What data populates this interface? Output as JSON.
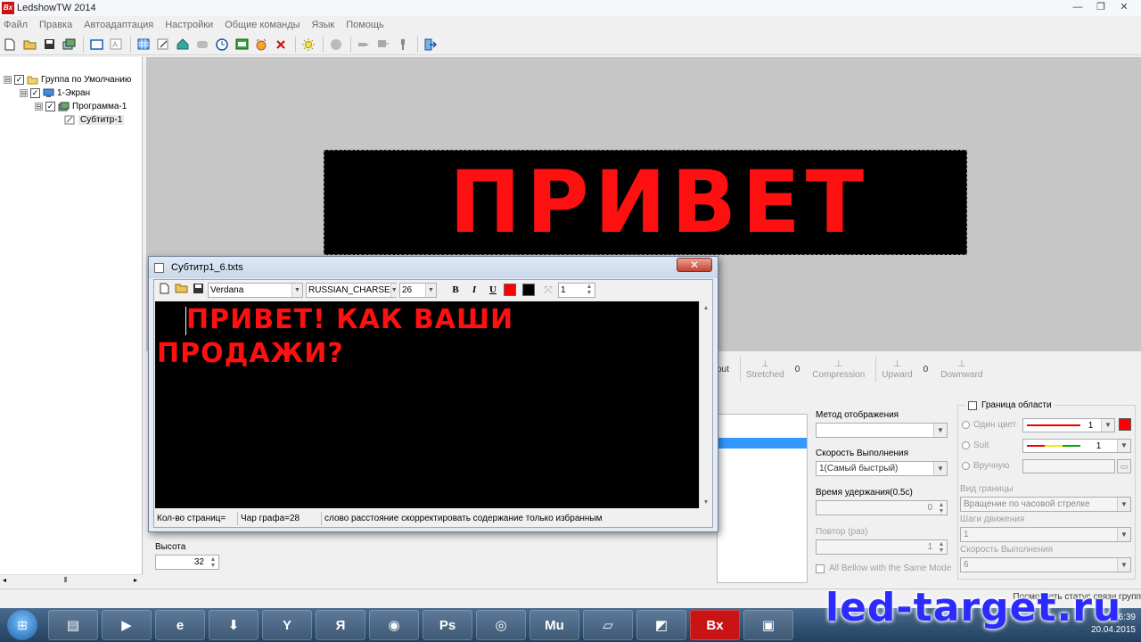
{
  "window": {
    "title": "LedshowTW 2014",
    "logo_text": "Bx",
    "min_glyph": "—",
    "max_glyph": "❐",
    "close_glyph": "✕"
  },
  "menu": [
    "Файл",
    "Правка",
    "Автоадаптация",
    "Настройки",
    "Общие команды",
    "Язык",
    "Помощь"
  ],
  "tree": {
    "expanders": [
      "⊟",
      "⊟",
      "⊟"
    ],
    "check": "✓",
    "group": "Группа по Умолчанию",
    "screen": "1-Экран",
    "program": "Программа-1",
    "subtitle": "Субтитр-1"
  },
  "hscroll": {
    "left": "◂",
    "thumb": "⦀",
    "right": "▸"
  },
  "led_preview": {
    "text": "ПРИВЕТ",
    "color": "#ff1010"
  },
  "effects": {
    "item_fragment": "out",
    "stretched": "Stretched",
    "stretched_value": "0",
    "compression": "Compression",
    "upward": "Upward",
    "upward_value": "0",
    "downward": "Downward"
  },
  "props": {
    "display_method_label": "Метод отображения",
    "display_method_value": "",
    "run_speed_label": "Скорость Выполнения",
    "run_speed_value": "1(Самый быстрый)",
    "hold_time_label": "Время удержания(0.5с)",
    "hold_time_value": "0",
    "repeat_label": "Повтор (раз)",
    "repeat_value": "1",
    "all_bellow_label": "All Bellow with the Same Mode",
    "height_label": "Высота",
    "height_value": "32"
  },
  "frame": {
    "border_label": "Граница области",
    "single_color": "Один цвет",
    "single_value": "1",
    "suit": "Suit",
    "suit_value": "1",
    "manual": "Вручную",
    "border_type_label": "Вид границы",
    "border_type_value": "Вращение по часовой стрелке",
    "move_steps_label": "Шаги движения",
    "move_steps_value": "1",
    "speed_label": "Скорость Выполнения",
    "speed_value": "6",
    "color": "#ff0000"
  },
  "status_right": "Посмотреть статус связи групп",
  "dialog": {
    "title": "Субтитр1_6.txts",
    "close_glyph": "✕",
    "font": "Verdana",
    "charset": "RUSSIAN_CHARSE",
    "size": "26",
    "bold": "B",
    "italic": "I",
    "underline": "U",
    "spacing": "1",
    "text": "ПРИВЕТ! КАК ВАШИ ПРОДАЖИ?",
    "text_color": "#ff1010",
    "scroll_up": "▲",
    "scroll_down": "▼",
    "status_pages": "Кол-во страниц=",
    "status_chars": "Чар графа=28",
    "status_hint": "слово расстояние скорректировать содержание только избранным"
  },
  "taskbar": {
    "apps": [
      "▤",
      "▶",
      "e",
      "⬇",
      "Y",
      "Я",
      "◉",
      "Ps",
      "◎",
      "Mu",
      "▱",
      "◩",
      "Bx",
      "▣"
    ],
    "time": "16:39",
    "date": "20.04.2015"
  },
  "watermark": "led-target.ru"
}
